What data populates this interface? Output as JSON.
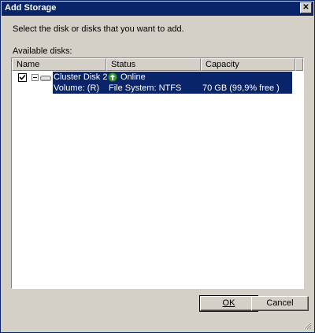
{
  "window": {
    "title": "Add Storage",
    "close_glyph": "✕"
  },
  "instruction": "Select the disk or disks that you want to add.",
  "available_label": "Available disks:",
  "columns": {
    "name": "Name",
    "status": "Status",
    "capacity": "Capacity"
  },
  "disk": {
    "checked": true,
    "name": "Cluster Disk 2",
    "status": "Online",
    "volume": "Volume: (R)",
    "file_system": "File System: NTFS",
    "capacity": "70 GB (99,9% free )"
  },
  "buttons": {
    "ok": "OK",
    "cancel": "Cancel"
  },
  "colors": {
    "selection": "#0a246a",
    "dialog": "#d4d0c8",
    "online": "#3a9a3a"
  }
}
